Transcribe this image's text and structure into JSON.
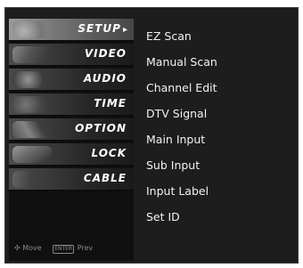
{
  "sidebar": {
    "tabs": [
      {
        "label": "SETUP",
        "arrow": "▸",
        "icon": "satellite-dish-icon"
      },
      {
        "label": "VIDEO",
        "icon": "video-icon"
      },
      {
        "label": "AUDIO",
        "icon": "speaker-icon"
      },
      {
        "label": "TIME",
        "icon": "clock-icon"
      },
      {
        "label": "OPTION",
        "icon": "option-icon"
      },
      {
        "label": "LOCK",
        "icon": "lock-icon"
      },
      {
        "label": "CABLE",
        "icon": "cable-icon"
      }
    ],
    "active_tab": "SETUP"
  },
  "hint": {
    "move_label": "Move",
    "enter_key": "ENTER",
    "prev_label": "Prev"
  },
  "menu": {
    "items": [
      {
        "label": "EZ Scan"
      },
      {
        "label": "Manual Scan"
      },
      {
        "label": "Channel Edit"
      },
      {
        "label": "DTV Signal"
      },
      {
        "label": "Main Input"
      },
      {
        "label": "Sub Input"
      },
      {
        "label": "Input Label"
      },
      {
        "label": "Set ID"
      }
    ]
  },
  "colors": {
    "background": "#1d1d1d",
    "active_tab": "#8a8a8a",
    "text": "#f2f2f2"
  }
}
